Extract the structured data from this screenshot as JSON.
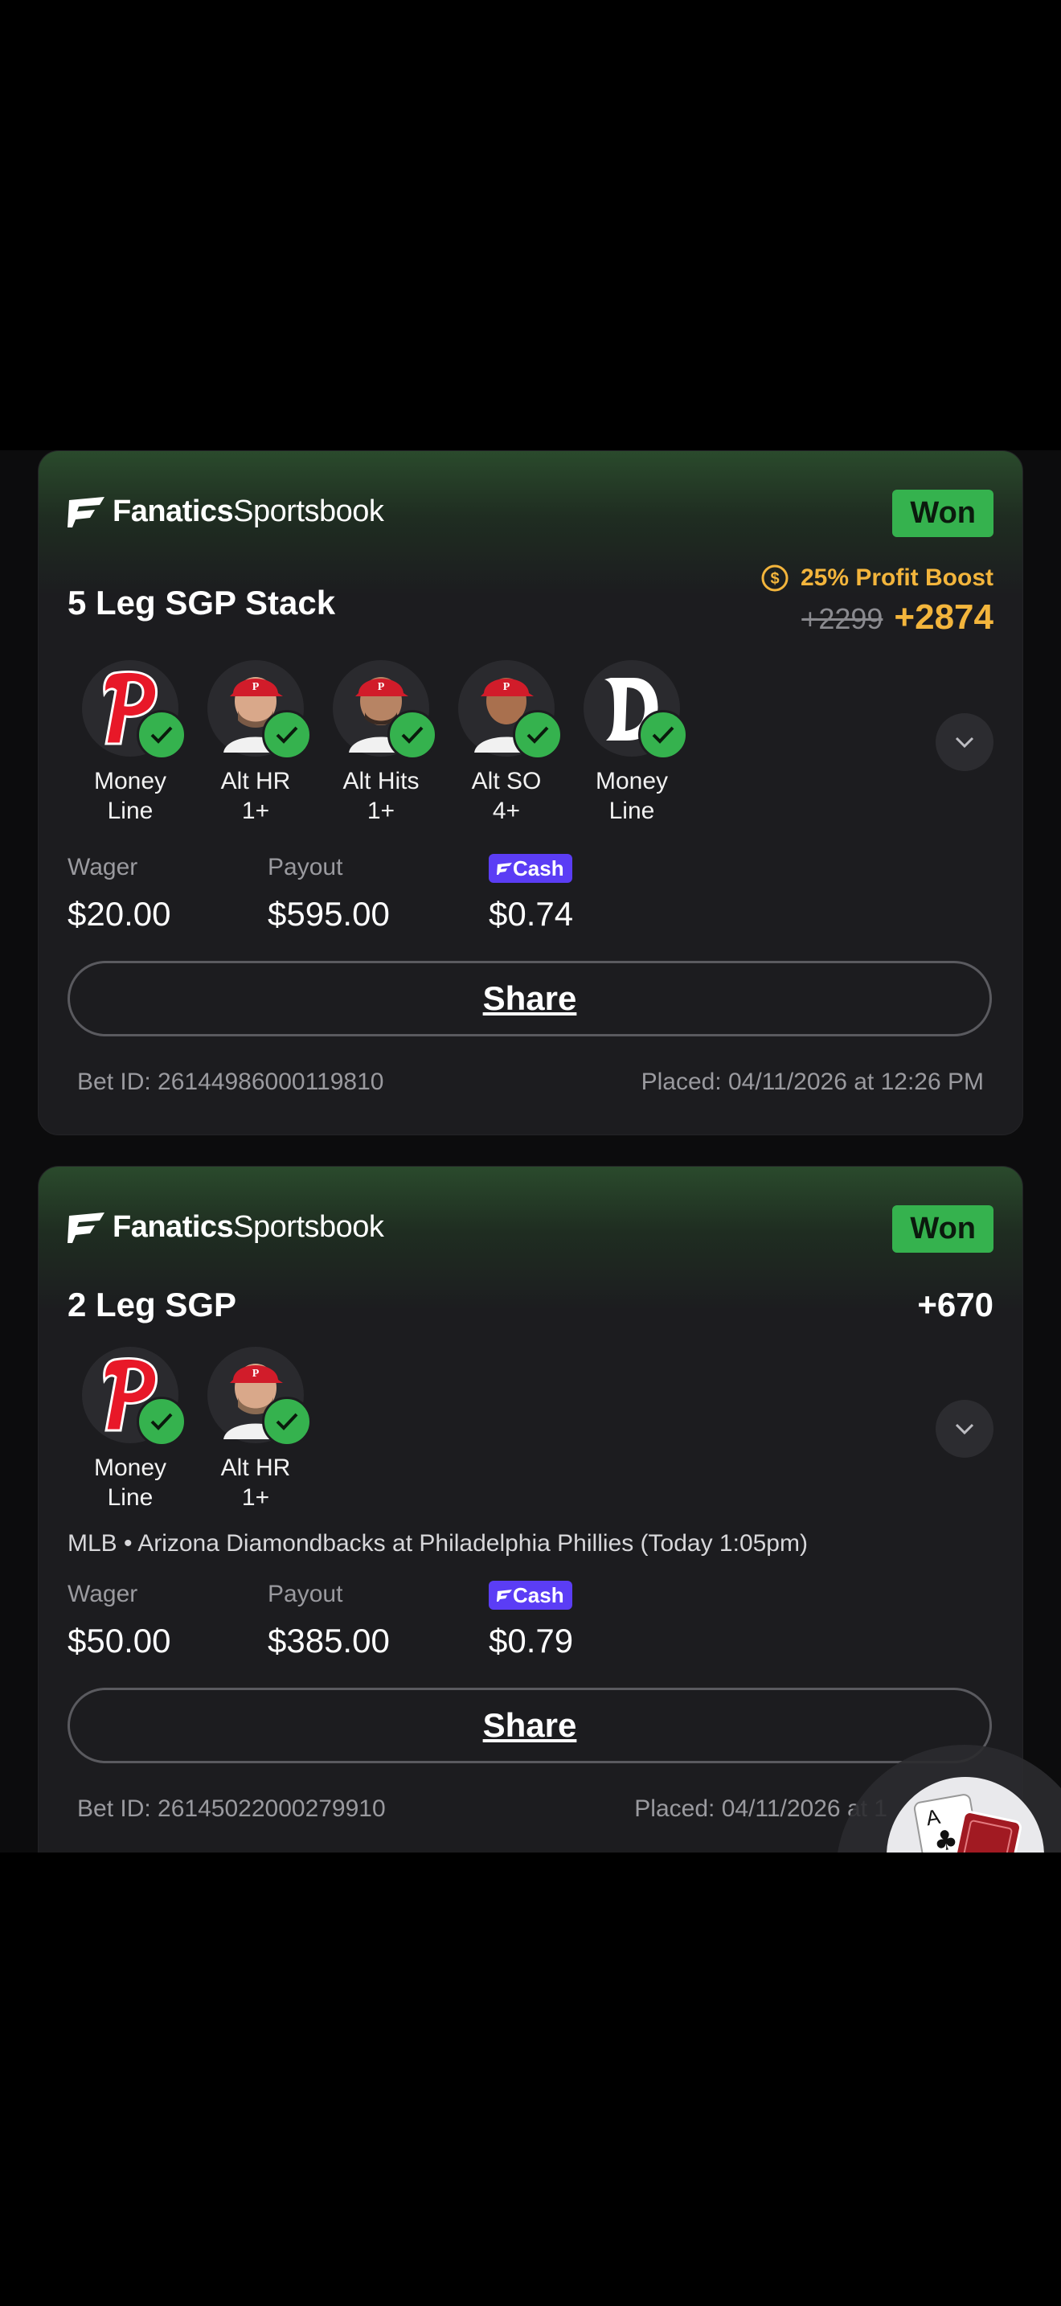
{
  "brand": {
    "bold": "Fanatics",
    "light": "Sportsbook"
  },
  "bets": [
    {
      "status": "Won",
      "title": "5 Leg SGP Stack",
      "boost_label": "25% Profit Boost",
      "odds_original": "+2299",
      "odds_boosted": "+2874",
      "legs": [
        {
          "line1": "Money",
          "line2": "Line",
          "avatar": "phillies-logo"
        },
        {
          "line1": "Alt HR",
          "line2": "1+",
          "avatar": "player-headshot"
        },
        {
          "line1": "Alt Hits",
          "line2": "1+",
          "avatar": "player-headshot"
        },
        {
          "line1": "Alt SO",
          "line2": "4+",
          "avatar": "player-headshot"
        },
        {
          "line1": "Money",
          "line2": "Line",
          "avatar": "tigers-logo"
        }
      ],
      "wager_label": "Wager",
      "wager": "$20.00",
      "payout_label": "Payout",
      "payout": "$595.00",
      "cash_label": "Cash",
      "cash": "$0.74",
      "share_label": "Share",
      "bet_id": "Bet ID: 26144986000119810",
      "placed": "Placed: 04/11/2026 at 12:26 PM"
    },
    {
      "status": "Won",
      "title": "2 Leg SGP",
      "odds": "+670",
      "legs": [
        {
          "line1": "Money",
          "line2": "Line",
          "avatar": "phillies-logo"
        },
        {
          "line1": "Alt HR",
          "line2": "1+",
          "avatar": "player-headshot"
        }
      ],
      "event": "MLB • Arizona Diamondbacks at Philadelphia Phillies (Today 1:05pm)",
      "wager_label": "Wager",
      "wager": "$50.00",
      "payout_label": "Payout",
      "payout": "$385.00",
      "cash_label": "Cash",
      "cash": "$0.79",
      "share_label": "Share",
      "bet_id": "Bet ID: 26145022000279910",
      "placed": "Placed: 04/11/2026 at 1"
    }
  ],
  "colors": {
    "won": "#35b24e",
    "boost": "#f3b53c",
    "cash": "#5b3df5",
    "card": "#1c1c1f"
  },
  "icons": [
    "fanatics-flag-icon",
    "profit-boost-coin-icon",
    "check-icon",
    "chevron-down-icon",
    "casino-cards-icon"
  ]
}
